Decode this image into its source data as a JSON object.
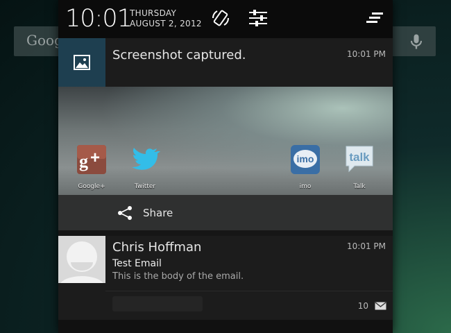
{
  "background": {
    "search_brand": "Goog",
    "icons": [
      "mic-icon"
    ]
  },
  "status_bar": {
    "time": "10:01",
    "day": "THURSDAY",
    "date": "AUGUST 2, 2012",
    "icons": [
      "auto-rotate-icon",
      "settings-sliders-icon",
      "clear-all-icon"
    ]
  },
  "notifications": [
    {
      "title": "Screenshot captured.",
      "time": "10:01 PM",
      "icon": "image-icon",
      "share_targets": [
        {
          "label": "Google+",
          "icon": "google-plus-icon",
          "color": "#8b4b3e"
        },
        {
          "label": "Twitter",
          "icon": "twitter-icon",
          "color": "#33ccff"
        },
        {
          "label": "imo",
          "icon": "imo-icon",
          "color": "#3a6ea5"
        },
        {
          "label": "Talk",
          "icon": "talk-icon",
          "color": "#4a8ac0"
        }
      ],
      "action": {
        "label": "Share",
        "icon": "share-icon"
      }
    },
    {
      "sender": "Chris Hoffman",
      "time": "10:01 PM",
      "subject": "Test Email",
      "body": "This is the body of the email.",
      "count": "10",
      "icon": "mail-icon"
    }
  ]
}
